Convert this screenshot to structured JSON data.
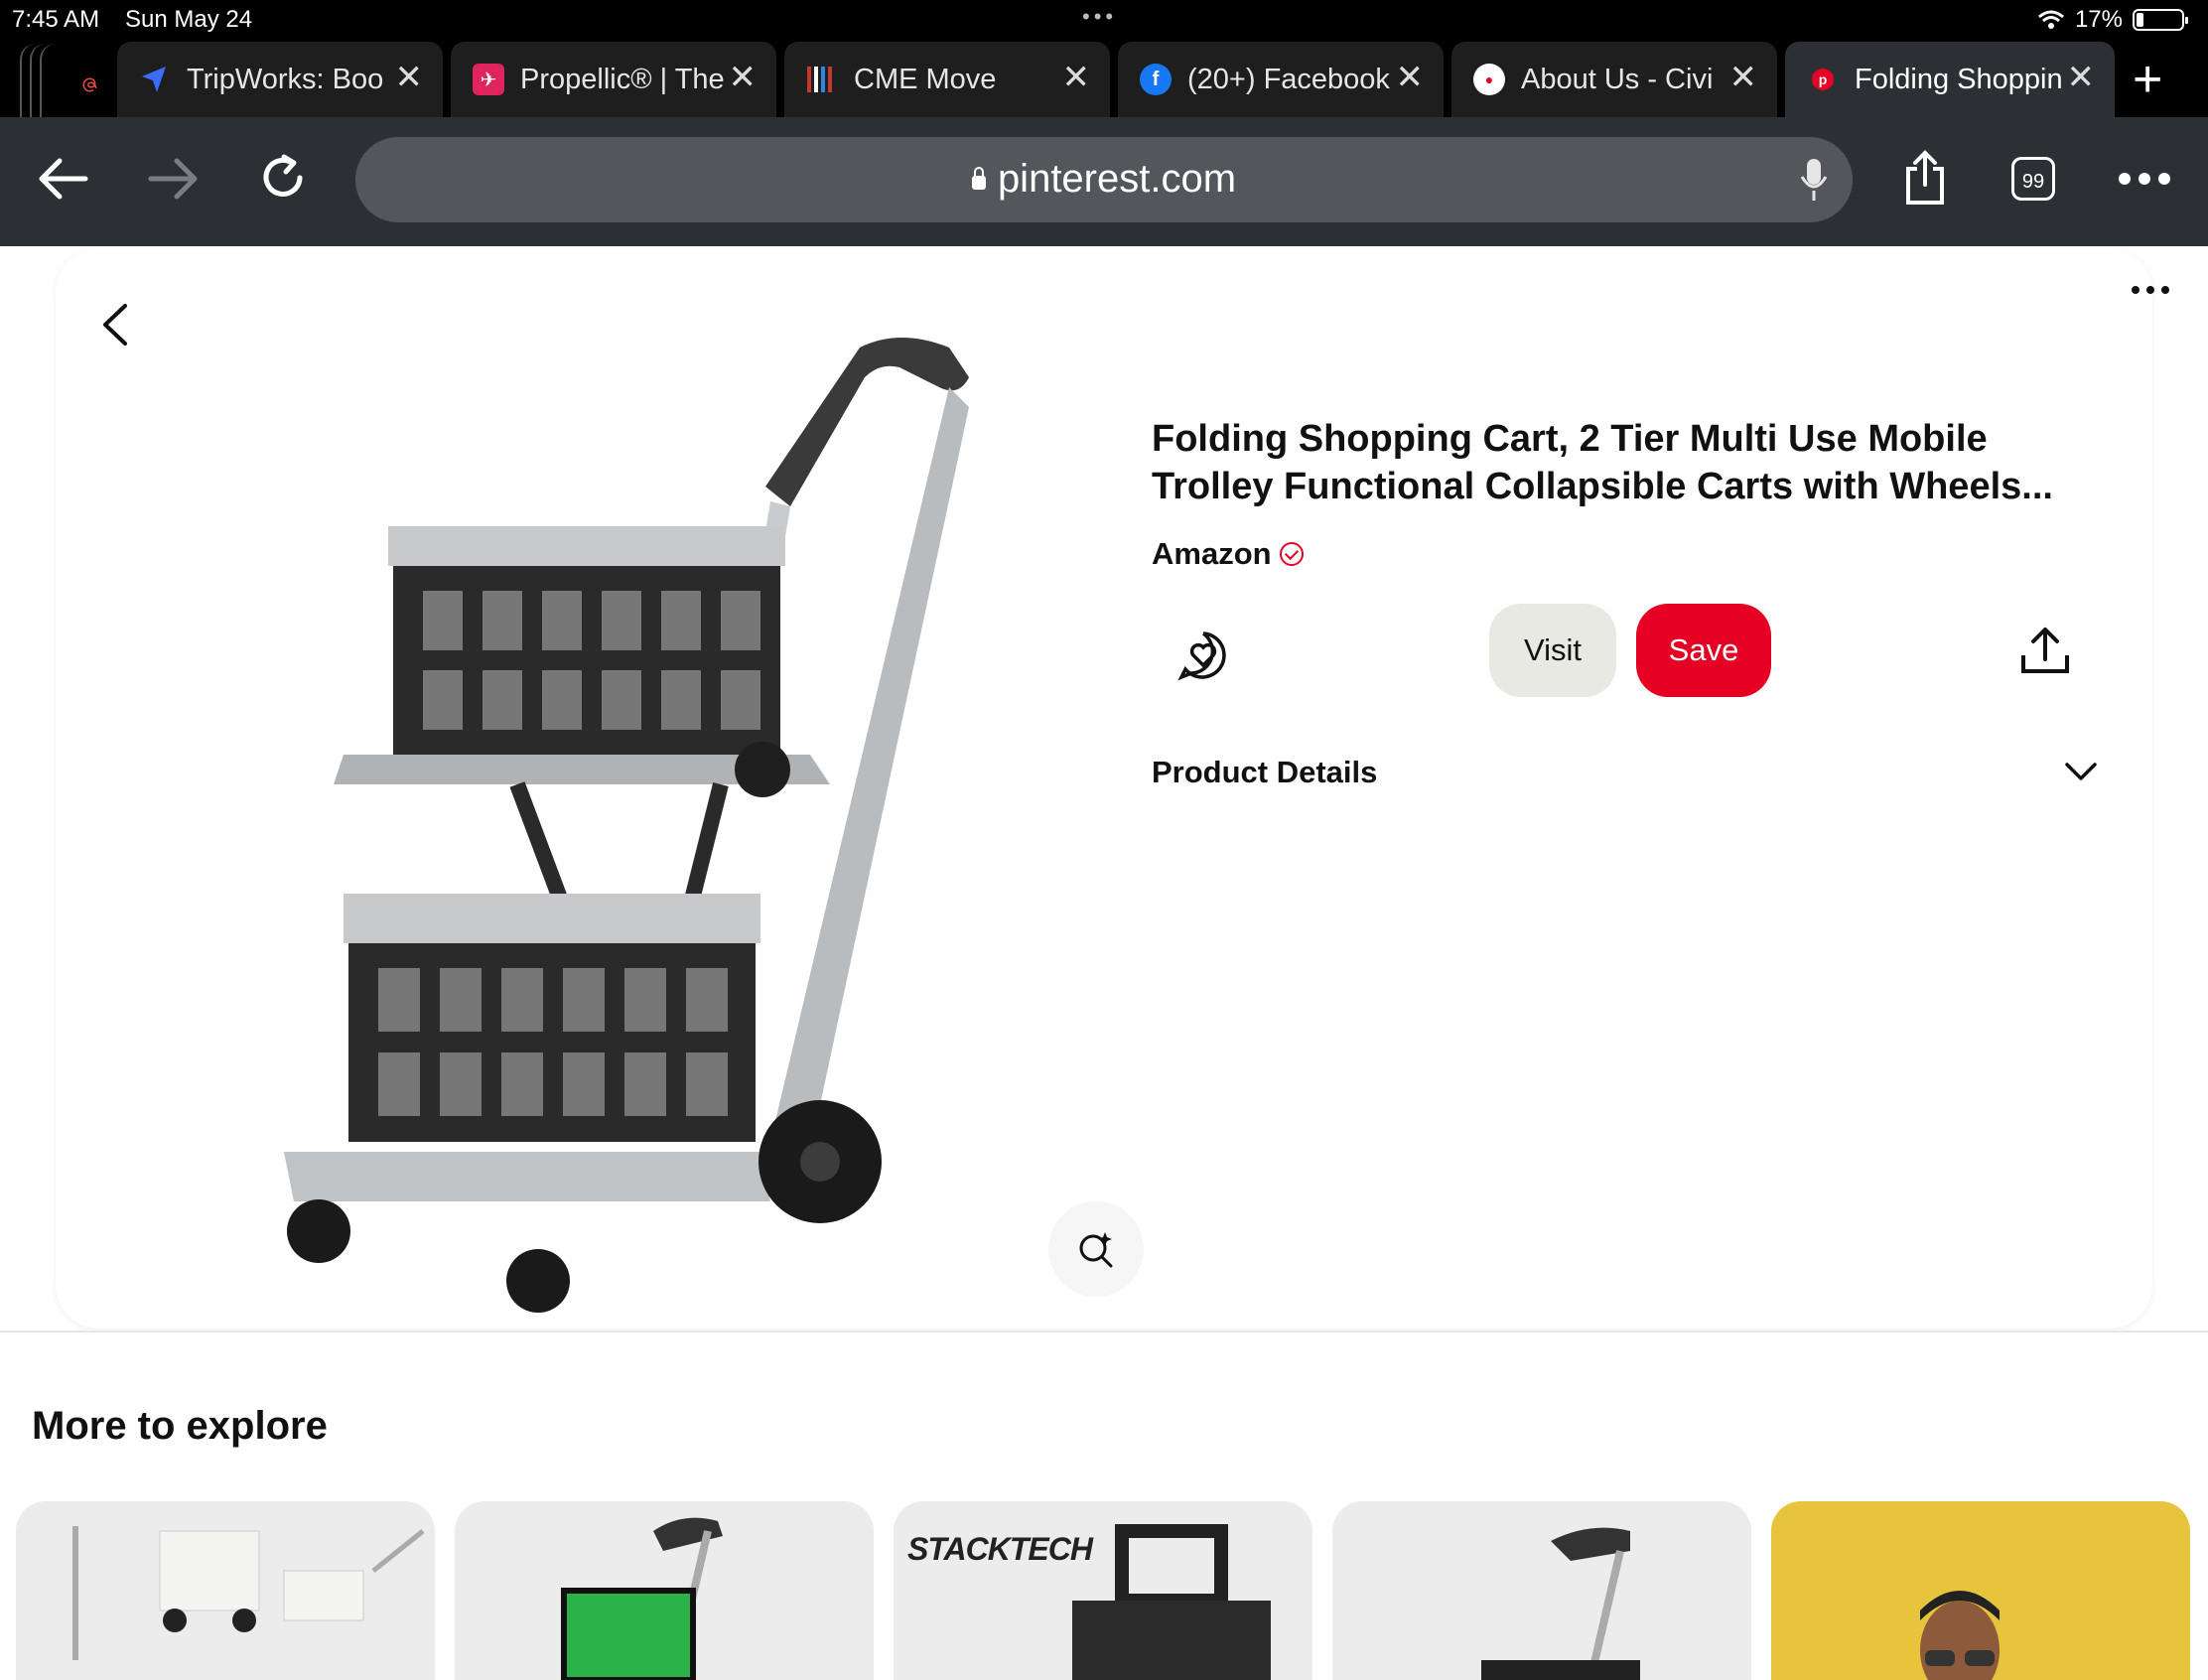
{
  "status_bar": {
    "time": "7:45 AM",
    "date": "Sun May 24",
    "battery": "17%",
    "battery_level": 0.17
  },
  "tabs": [
    {
      "title": "TripWorks: Boo",
      "icon": "navigation-arrow-icon",
      "color": "#3b6cff"
    },
    {
      "title": "Propellic® | The",
      "icon": "propellic-logo-icon",
      "color": "#e0245e"
    },
    {
      "title": "CME Move",
      "icon": "cme-logo-icon",
      "color": "#c0392b"
    },
    {
      "title": "(20+) Facebook",
      "icon": "facebook-icon",
      "color": "#1877f2"
    },
    {
      "title": "About Us - Civi",
      "icon": "civi-logo-icon",
      "color": "#ffffff"
    },
    {
      "title": "Folding Shoppin",
      "icon": "pinterest-icon",
      "color": "#e60023",
      "active": true
    }
  ],
  "toolbar": {
    "url": "pinterest.com",
    "tab_count": "99"
  },
  "pin": {
    "title": "Folding Shopping Cart, 2 Tier Multi Use Mobile Trolley Functional Collapsible Carts with Wheels...",
    "seller": "Amazon",
    "visit_label": "Visit",
    "save_label": "Save",
    "details_label": "Product Details"
  },
  "explore": {
    "title": "More to explore",
    "tile_brand": "STACKTECH",
    "tile_colors": [
      "#ececec",
      "#ececec",
      "#ececec",
      "#ececec",
      "#e8c43c"
    ]
  },
  "colors": {
    "accent": "#e60023",
    "toolbar": "#2c2f33",
    "tab_bar": "#000000"
  }
}
